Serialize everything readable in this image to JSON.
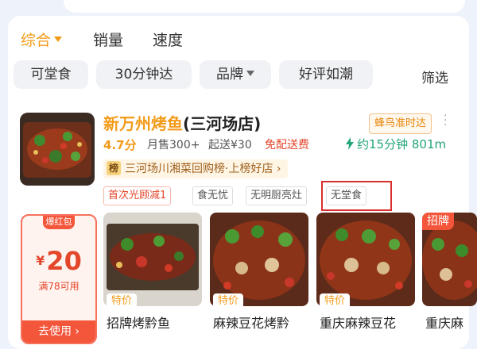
{
  "sort_bar": {
    "items": [
      "综合",
      "销量",
      "速度"
    ],
    "active": 0
  },
  "filter_chips": [
    "可堂食",
    "30分钟达",
    "品牌",
    "好评如潮"
  ],
  "filter_label": "筛选",
  "store": {
    "name_highlight": "新万州烤鱼",
    "name_rest": "(三河场店)",
    "rider_tag": "蜂鸟准时达",
    "rating": "4.7分",
    "sales": "月售300+",
    "min_price": "起送¥30",
    "free_shipping": "免配送费",
    "eta": "约15分钟 801m",
    "rank_badge": "榜",
    "rank_text": "三河场川湘菜回购榜·上榜好店 ›",
    "promo_tags": [
      "首次光顾减1",
      "食无忧",
      "无明厨亮灶",
      "无堂食"
    ]
  },
  "coupon": {
    "tag": "爆红包",
    "currency": "¥",
    "amount": "20",
    "condition": "满78可用",
    "button": "去使用 ›"
  },
  "dishes": [
    {
      "sale_tag": "特价",
      "name": "招牌烤黔鱼",
      "badge": ""
    },
    {
      "sale_tag": "特价",
      "name": "麻辣豆花烤黔",
      "badge": ""
    },
    {
      "sale_tag": "特价",
      "name": "重庆麻辣豆花",
      "badge": ""
    },
    {
      "sale_tag": "",
      "name": "重庆麻",
      "badge": "招牌"
    }
  ],
  "colors": {
    "accent": "#f39b19",
    "price_red": "#e3462b",
    "eta_green": "#23a57a",
    "highlight_box": "#d9302e"
  }
}
